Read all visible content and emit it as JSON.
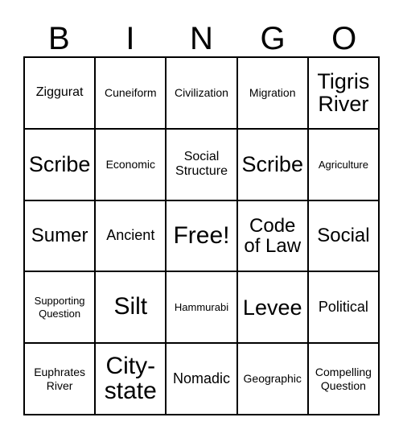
{
  "card": {
    "header_letters": [
      "B",
      "I",
      "N",
      "G",
      "O"
    ],
    "columns": 5,
    "rows": 5,
    "colors": {
      "background": "#ffffff",
      "border": "#000000",
      "text": "#000000"
    },
    "cells": [
      [
        {
          "label": "Ziggurat",
          "size": "md",
          "free": false
        },
        {
          "label": "Cuneiform",
          "size": "sm",
          "free": false
        },
        {
          "label": "Civilization",
          "size": "sm",
          "free": false
        },
        {
          "label": "Migration",
          "size": "sm",
          "free": false
        },
        {
          "label": "Tigris River",
          "size": "2xl",
          "free": false
        }
      ],
      [
        {
          "label": "Scribe",
          "size": "2xl",
          "free": false
        },
        {
          "label": "Economic",
          "size": "sm",
          "free": false
        },
        {
          "label": "Social Structure",
          "size": "md",
          "free": false
        },
        {
          "label": "Scribe",
          "size": "2xl",
          "free": false
        },
        {
          "label": "Agriculture",
          "size": "xs",
          "free": false
        }
      ],
      [
        {
          "label": "Sumer",
          "size": "xl",
          "free": false
        },
        {
          "label": "Ancient",
          "size": "lg",
          "free": false
        },
        {
          "label": "Free!",
          "size": "3xl",
          "free": true
        },
        {
          "label": "Code of Law",
          "size": "xl",
          "free": false
        },
        {
          "label": "Social",
          "size": "xl",
          "free": false
        }
      ],
      [
        {
          "label": "Supporting Question",
          "size": "xs",
          "free": false
        },
        {
          "label": "Silt",
          "size": "3xl",
          "free": false
        },
        {
          "label": "Hammurabi",
          "size": "xs",
          "free": false
        },
        {
          "label": "Levee",
          "size": "2xl",
          "free": false
        },
        {
          "label": "Political",
          "size": "lg",
          "free": false
        }
      ],
      [
        {
          "label": "Euphrates River",
          "size": "sm",
          "free": false
        },
        {
          "label": "City-state",
          "size": "3xl",
          "free": false
        },
        {
          "label": "Nomadic",
          "size": "lg",
          "free": false
        },
        {
          "label": "Geographic",
          "size": "sm",
          "free": false
        },
        {
          "label": "Compelling Question",
          "size": "sm",
          "free": false
        }
      ]
    ]
  }
}
